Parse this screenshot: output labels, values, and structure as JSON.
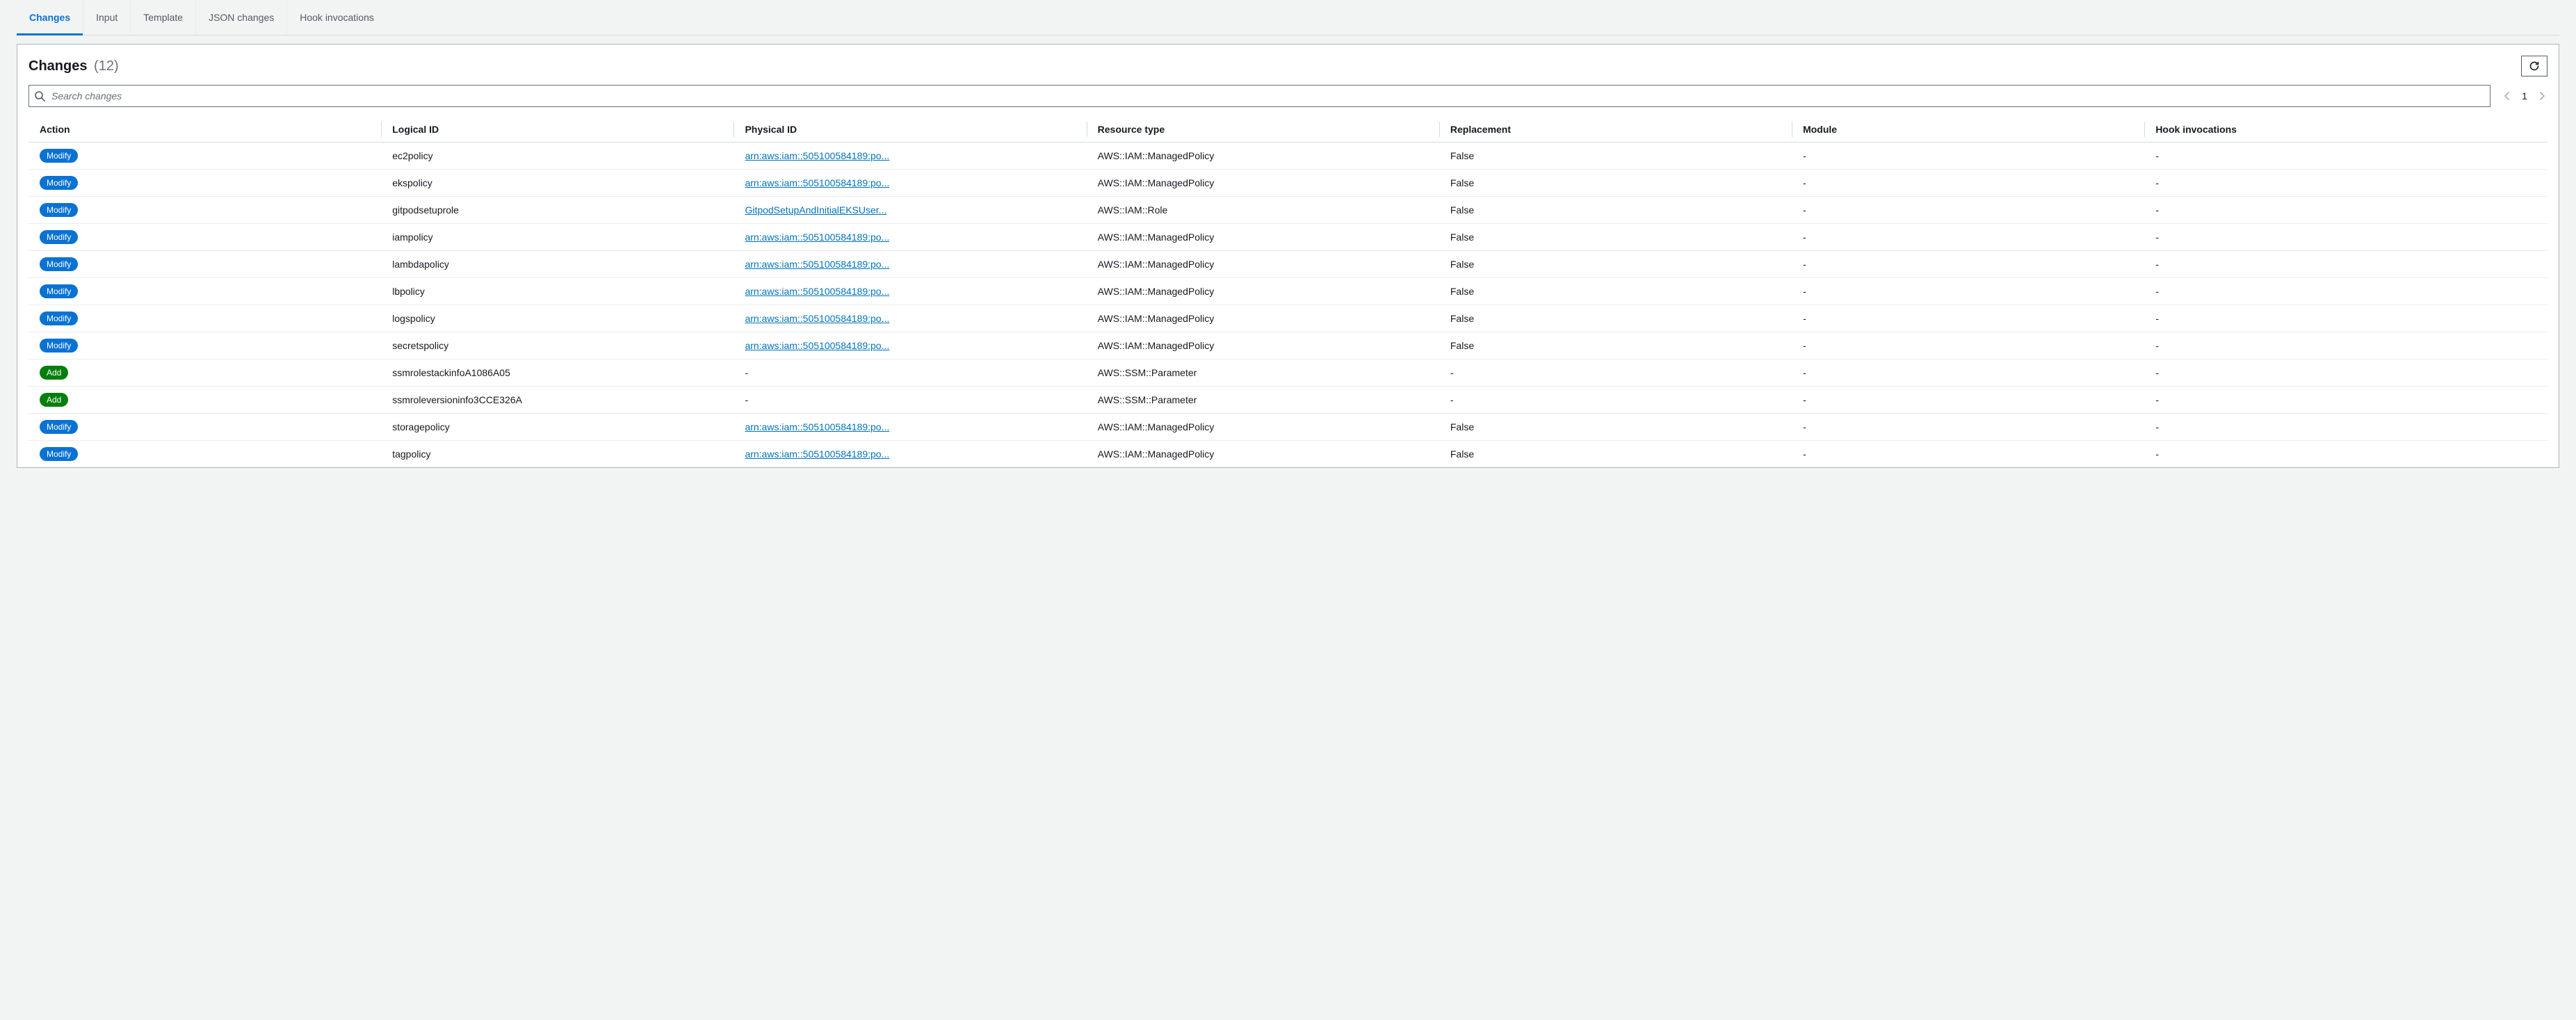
{
  "tabs": [
    {
      "label": "Changes",
      "active": true
    },
    {
      "label": "Input",
      "active": false
    },
    {
      "label": "Template",
      "active": false
    },
    {
      "label": "JSON changes",
      "active": false
    },
    {
      "label": "Hook invocations",
      "active": false
    }
  ],
  "panel": {
    "title": "Changes",
    "count_display": "(12)"
  },
  "search": {
    "placeholder": "Search changes"
  },
  "pagination": {
    "current": "1"
  },
  "columns": {
    "action": "Action",
    "logical_id": "Logical ID",
    "physical_id": "Physical ID",
    "resource_type": "Resource type",
    "replacement": "Replacement",
    "module": "Module",
    "hook_invocations": "Hook invocations"
  },
  "action_labels": {
    "Modify": "Modify",
    "Add": "Add"
  },
  "rows": [
    {
      "action": "Modify",
      "logical_id": "ec2policy",
      "physical_id": "arn:aws:iam::505100584189:po...",
      "physical_id_is_link": true,
      "resource_type": "AWS::IAM::ManagedPolicy",
      "replacement": "False",
      "module": "-",
      "hook": "-"
    },
    {
      "action": "Modify",
      "logical_id": "ekspolicy",
      "physical_id": "arn:aws:iam::505100584189:po...",
      "physical_id_is_link": true,
      "resource_type": "AWS::IAM::ManagedPolicy",
      "replacement": "False",
      "module": "-",
      "hook": "-"
    },
    {
      "action": "Modify",
      "logical_id": "gitpodsetuprole",
      "physical_id": "GitpodSetupAndInitialEKSUser...",
      "physical_id_is_link": true,
      "resource_type": "AWS::IAM::Role",
      "replacement": "False",
      "module": "-",
      "hook": "-"
    },
    {
      "action": "Modify",
      "logical_id": "iampolicy",
      "physical_id": "arn:aws:iam::505100584189:po...",
      "physical_id_is_link": true,
      "resource_type": "AWS::IAM::ManagedPolicy",
      "replacement": "False",
      "module": "-",
      "hook": "-"
    },
    {
      "action": "Modify",
      "logical_id": "lambdapolicy",
      "physical_id": "arn:aws:iam::505100584189:po...",
      "physical_id_is_link": true,
      "resource_type": "AWS::IAM::ManagedPolicy",
      "replacement": "False",
      "module": "-",
      "hook": "-"
    },
    {
      "action": "Modify",
      "logical_id": "lbpolicy",
      "physical_id": "arn:aws:iam::505100584189:po...",
      "physical_id_is_link": true,
      "resource_type": "AWS::IAM::ManagedPolicy",
      "replacement": "False",
      "module": "-",
      "hook": "-"
    },
    {
      "action": "Modify",
      "logical_id": "logspolicy",
      "physical_id": "arn:aws:iam::505100584189:po...",
      "physical_id_is_link": true,
      "resource_type": "AWS::IAM::ManagedPolicy",
      "replacement": "False",
      "module": "-",
      "hook": "-"
    },
    {
      "action": "Modify",
      "logical_id": "secretspolicy",
      "physical_id": "arn:aws:iam::505100584189:po...",
      "physical_id_is_link": true,
      "resource_type": "AWS::IAM::ManagedPolicy",
      "replacement": "False",
      "module": "-",
      "hook": "-"
    },
    {
      "action": "Add",
      "logical_id": "ssmrolestackinfoA1086A05",
      "physical_id": "-",
      "physical_id_is_link": false,
      "resource_type": "AWS::SSM::Parameter",
      "replacement": "-",
      "module": "-",
      "hook": "-"
    },
    {
      "action": "Add",
      "logical_id": "ssmroleversioninfo3CCE326A",
      "physical_id": "-",
      "physical_id_is_link": false,
      "resource_type": "AWS::SSM::Parameter",
      "replacement": "-",
      "module": "-",
      "hook": "-"
    },
    {
      "action": "Modify",
      "logical_id": "storagepolicy",
      "physical_id": "arn:aws:iam::505100584189:po...",
      "physical_id_is_link": true,
      "resource_type": "AWS::IAM::ManagedPolicy",
      "replacement": "False",
      "module": "-",
      "hook": "-"
    },
    {
      "action": "Modify",
      "logical_id": "tagpolicy",
      "physical_id": "arn:aws:iam::505100584189:po...",
      "physical_id_is_link": true,
      "resource_type": "AWS::IAM::ManagedPolicy",
      "replacement": "False",
      "module": "-",
      "hook": "-"
    }
  ]
}
